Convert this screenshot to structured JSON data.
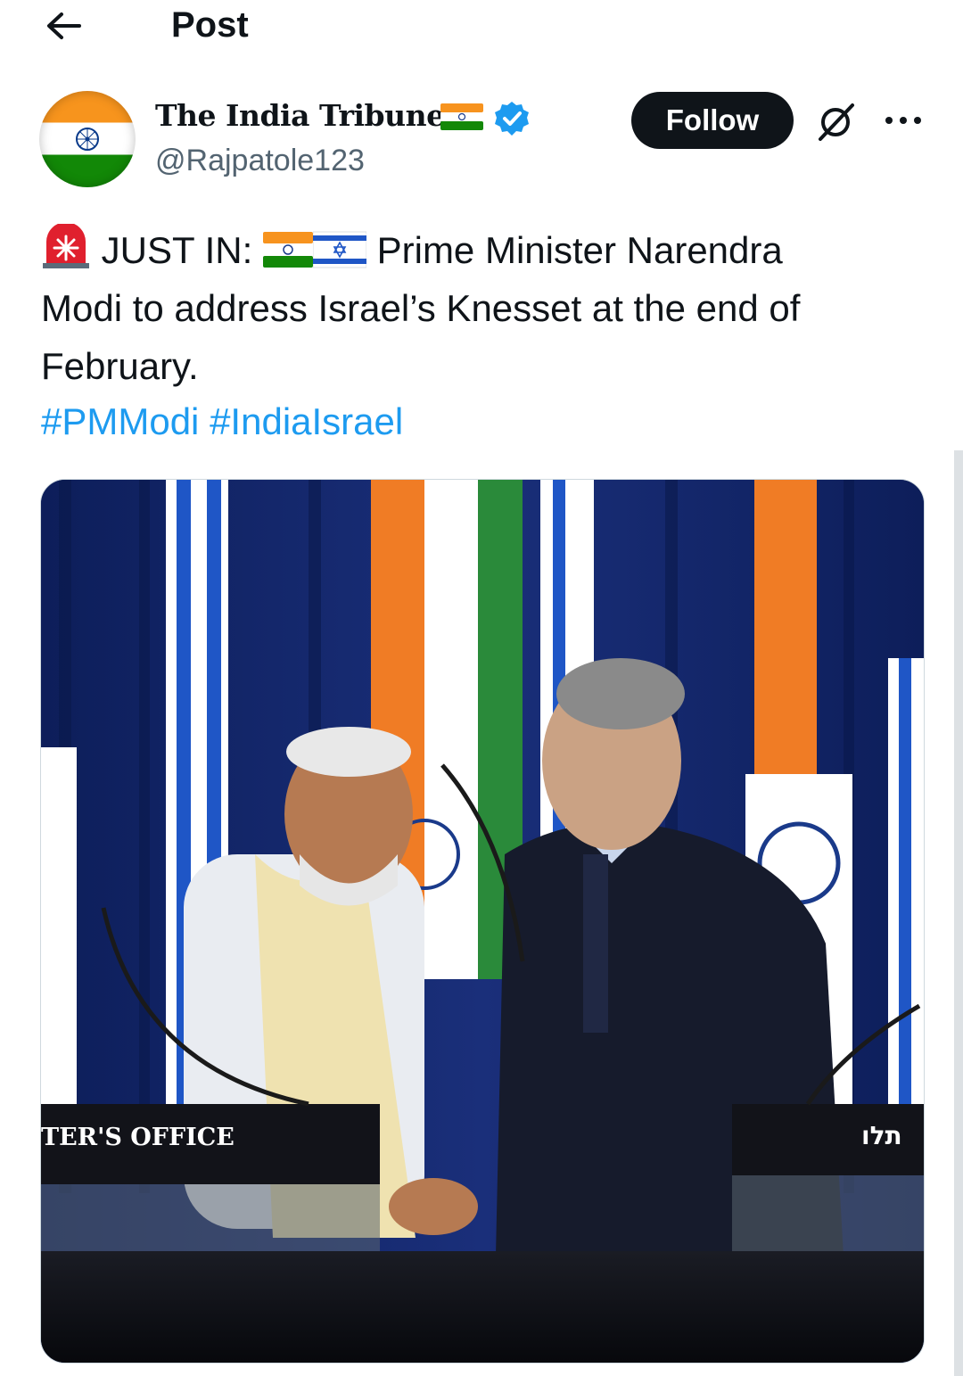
{
  "header": {
    "title": "Post",
    "back_icon": "back-arrow-icon"
  },
  "author": {
    "display_name": "The India Tribune",
    "handle": "@Rajpatole123",
    "verified": true,
    "name_emoji": "india-flag-icon"
  },
  "actions": {
    "follow_label": "Follow",
    "grok_icon": "grok-icon",
    "more_icon": "more-options-icon"
  },
  "post": {
    "prefix_emoji": "rotating-light-icon",
    "flags": [
      "india-flag-icon",
      "israel-flag-icon"
    ],
    "lead": "JUST IN:",
    "line1_rest": "Prime Minister Narendra",
    "line2": "Modi to address Israel’s Knesset at the end of",
    "line3": "February.",
    "hashtags": [
      "#PMModi",
      "#IndiaIsrael"
    ]
  },
  "media": {
    "podium_left_text": "TER'S  OFFICE",
    "podium_right_text": "תלו"
  },
  "colors": {
    "text": "#0f1419",
    "secondary": "#536471",
    "link": "#1d9bf0",
    "verified": "#1d9bf0",
    "follow_bg": "#0f1419"
  }
}
